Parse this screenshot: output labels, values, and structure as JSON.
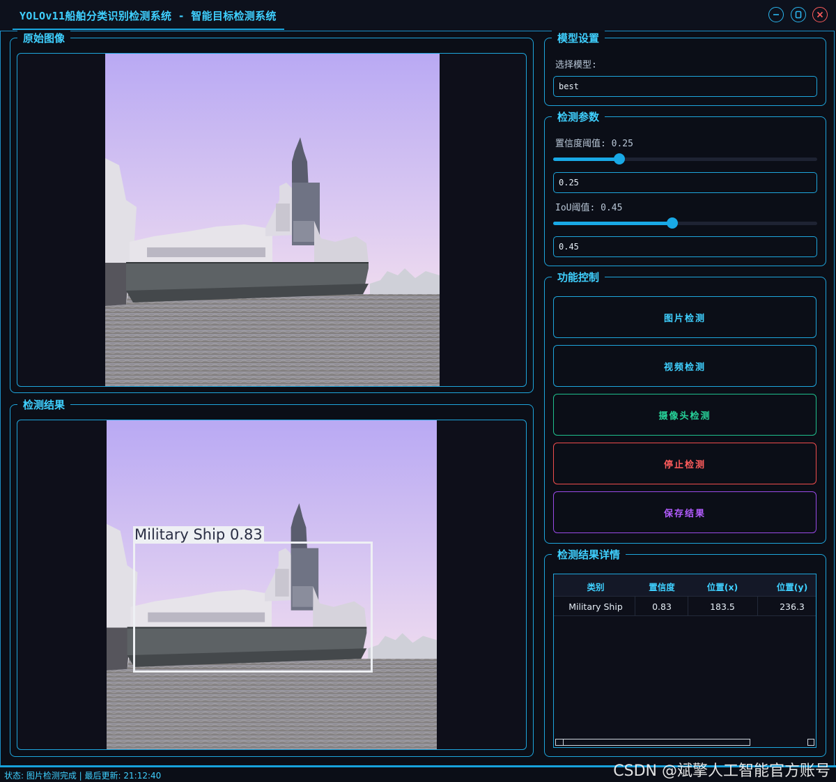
{
  "window": {
    "title": "YOLOv11船舶分类识别检测系统 - 智能目标检测系统",
    "controls": [
      "minimize",
      "maximize",
      "close"
    ]
  },
  "panels": {
    "original": {
      "title": "原始图像"
    },
    "result": {
      "title": "检测结果",
      "detection_label": "Military Ship 0.83"
    }
  },
  "model_settings": {
    "title": "模型设置",
    "select_label": "选择模型:",
    "selected_model": "best"
  },
  "detection_params": {
    "title": "检测参数",
    "confidence_label": "置信度阈值: 0.25",
    "confidence_value": "0.25",
    "confidence_fraction": 0.25,
    "iou_label": "IoU阈值: 0.45",
    "iou_value": "0.45",
    "iou_fraction": 0.45
  },
  "function_control": {
    "title": "功能控制",
    "image_detect": "图片检测",
    "video_detect": "视频检测",
    "camera_detect": "摄像头检测",
    "stop_detect": "停止检测",
    "save_results": "保存结果"
  },
  "results_detail": {
    "title": "检测结果详情",
    "columns": [
      "类别",
      "置信度",
      "位置(x)",
      "位置(y)"
    ],
    "rows": [
      {
        "class": "Military Ship",
        "confidence": "0.83",
        "x": "183.5",
        "y": "236.3"
      }
    ]
  },
  "status_bar": {
    "text": "状态: 图片检测完成 | 最后更新: 21:12:40"
  },
  "watermark": "CSDN @斌擎人工智能官方账号",
  "colors": {
    "accent": "#3fd0ff",
    "camera": "#27d39a",
    "stop": "#ff5c5c",
    "save": "#b35cff"
  }
}
